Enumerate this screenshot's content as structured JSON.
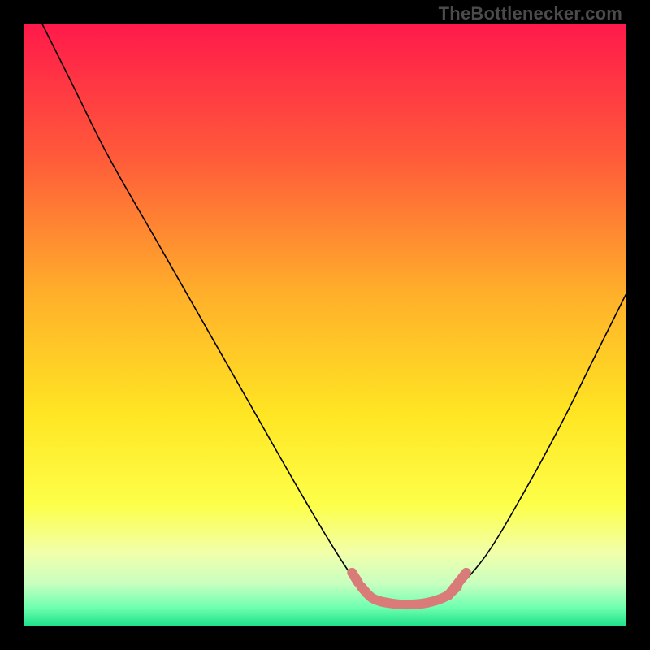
{
  "watermark": "TheBottlenecker.com",
  "chart_data": {
    "type": "line",
    "title": "",
    "xlabel": "",
    "ylabel": "",
    "xlim": [
      0,
      100
    ],
    "ylim": [
      0,
      100
    ],
    "grid": false,
    "legend": false,
    "gradient_stops": [
      {
        "pct": 0,
        "color": "#ff1a4b"
      },
      {
        "pct": 22,
        "color": "#ff5a3a"
      },
      {
        "pct": 45,
        "color": "#ffb02a"
      },
      {
        "pct": 65,
        "color": "#ffe623"
      },
      {
        "pct": 80,
        "color": "#fdff4a"
      },
      {
        "pct": 88,
        "color": "#f1ffab"
      },
      {
        "pct": 93,
        "color": "#c8ffc0"
      },
      {
        "pct": 97,
        "color": "#6fffb0"
      },
      {
        "pct": 100,
        "color": "#1fe28a"
      }
    ],
    "series": [
      {
        "name": "left-branch",
        "stroke": "#000000",
        "stroke_width": 1.6,
        "points": [
          {
            "x": 3,
            "y": 100
          },
          {
            "x": 8,
            "y": 90
          },
          {
            "x": 14,
            "y": 78
          },
          {
            "x": 22,
            "y": 64
          },
          {
            "x": 30,
            "y": 50
          },
          {
            "x": 38,
            "y": 36
          },
          {
            "x": 46,
            "y": 22
          },
          {
            "x": 52,
            "y": 12
          },
          {
            "x": 56,
            "y": 6
          }
        ]
      },
      {
        "name": "right-branch",
        "stroke": "#000000",
        "stroke_width": 1.6,
        "points": [
          {
            "x": 72,
            "y": 6
          },
          {
            "x": 77,
            "y": 12
          },
          {
            "x": 83,
            "y": 22
          },
          {
            "x": 89,
            "y": 33
          },
          {
            "x": 95,
            "y": 45
          },
          {
            "x": 100,
            "y": 55
          }
        ]
      },
      {
        "name": "bottom-arc",
        "stroke": "#d97b78",
        "stroke_width": 12,
        "points": [
          {
            "x": 56,
            "y": 6.5
          },
          {
            "x": 58,
            "y": 4.5
          },
          {
            "x": 61,
            "y": 3.7
          },
          {
            "x": 64,
            "y": 3.5
          },
          {
            "x": 67,
            "y": 3.8
          },
          {
            "x": 70,
            "y": 4.8
          },
          {
            "x": 72,
            "y": 6.5
          }
        ]
      },
      {
        "name": "left-dot",
        "stroke": "#d97b78",
        "stroke_width": 12,
        "points": [
          {
            "x": 54.5,
            "y": 8.8
          },
          {
            "x": 55.5,
            "y": 7.2
          }
        ]
      },
      {
        "name": "right-dash",
        "stroke": "#d97b78",
        "stroke_width": 12,
        "points": [
          {
            "x": 70.5,
            "y": 5.0
          },
          {
            "x": 73.5,
            "y": 8.8
          }
        ]
      }
    ]
  }
}
